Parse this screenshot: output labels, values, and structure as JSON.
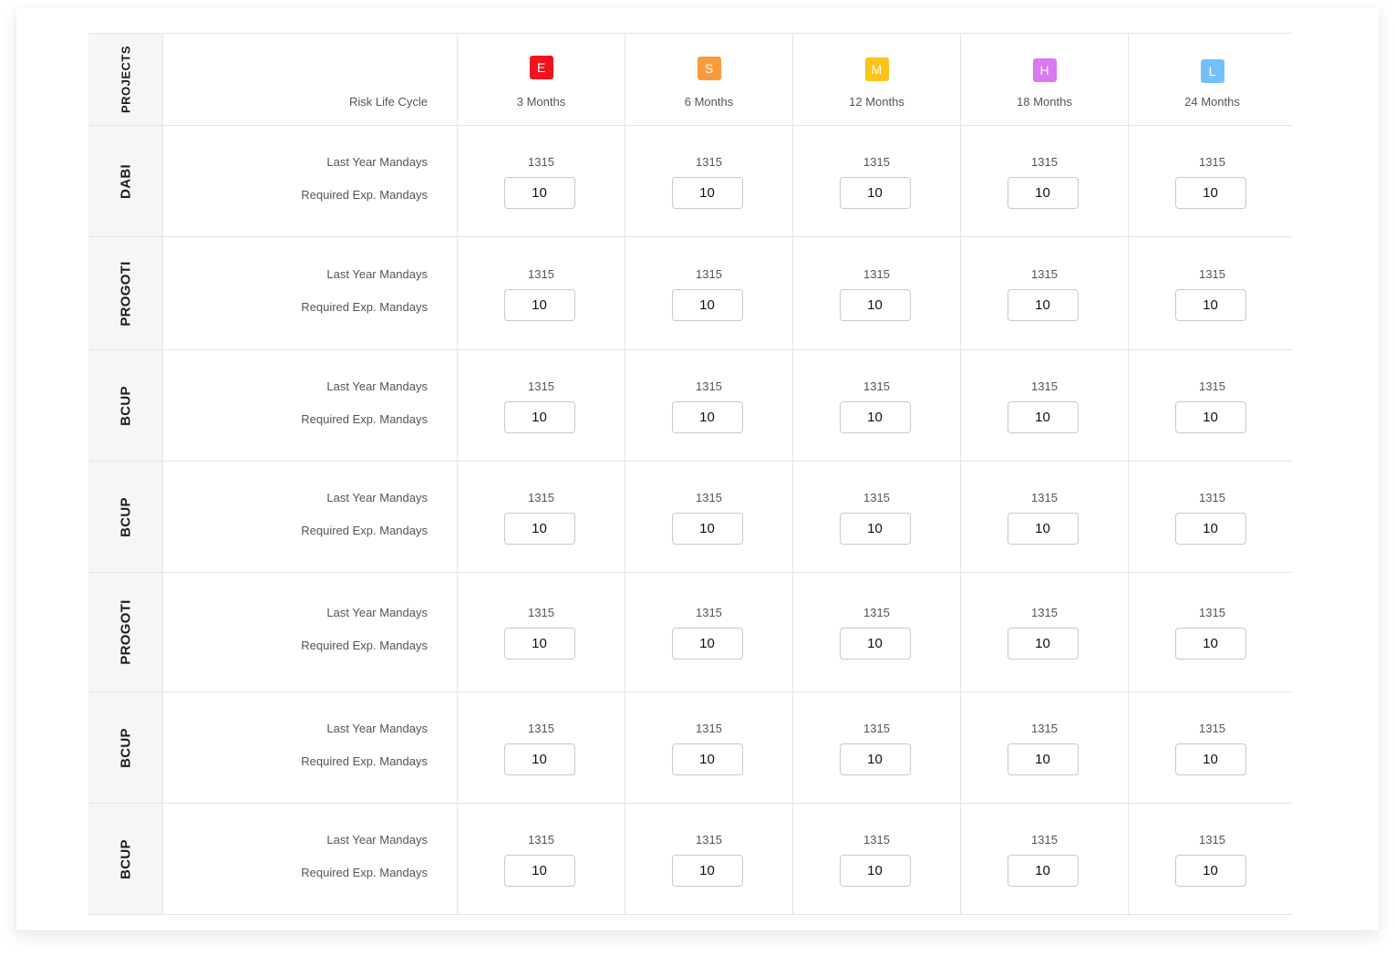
{
  "header": {
    "projects_label": "PROJECTS",
    "risk_label": "Risk Life Cycle",
    "columns": [
      {
        "badge": "E",
        "label": "3 Months",
        "color": "#f0131e"
      },
      {
        "badge": "S",
        "label": "6 Months",
        "color": "#f99a3c"
      },
      {
        "badge": "M",
        "label": "12 Months",
        "color": "#fcc419"
      },
      {
        "badge": "H",
        "label": "18 Months",
        "color": "#da77f2"
      },
      {
        "badge": "L",
        "label": "24 Months",
        "color": "#74c0fc"
      }
    ]
  },
  "row_labels": {
    "last_year": "Last Year Mandays",
    "required": "Required Exp. Mandays"
  },
  "rows": [
    {
      "project": "DABI",
      "values": [
        {
          "last": "1315",
          "required": "10"
        },
        {
          "last": "1315",
          "required": "10"
        },
        {
          "last": "1315",
          "required": "10"
        },
        {
          "last": "1315",
          "required": "10"
        },
        {
          "last": "1315",
          "required": "10"
        }
      ]
    },
    {
      "project": "PROGOTI",
      "values": [
        {
          "last": "1315",
          "required": "10"
        },
        {
          "last": "1315",
          "required": "10"
        },
        {
          "last": "1315",
          "required": "10"
        },
        {
          "last": "1315",
          "required": "10"
        },
        {
          "last": "1315",
          "required": "10"
        }
      ]
    },
    {
      "project": "BCUP",
      "values": [
        {
          "last": "1315",
          "required": "10"
        },
        {
          "last": "1315",
          "required": "10"
        },
        {
          "last": "1315",
          "required": "10"
        },
        {
          "last": "1315",
          "required": "10"
        },
        {
          "last": "1315",
          "required": "10"
        }
      ]
    },
    {
      "project": "BCUP",
      "values": [
        {
          "last": "1315",
          "required": "10"
        },
        {
          "last": "1315",
          "required": "10"
        },
        {
          "last": "1315",
          "required": "10"
        },
        {
          "last": "1315",
          "required": "10"
        },
        {
          "last": "1315",
          "required": "10"
        }
      ]
    },
    {
      "project": "PROGOTI",
      "values": [
        {
          "last": "1315",
          "required": "10"
        },
        {
          "last": "1315",
          "required": "10"
        },
        {
          "last": "1315",
          "required": "10"
        },
        {
          "last": "1315",
          "required": "10"
        },
        {
          "last": "1315",
          "required": "10"
        }
      ]
    },
    {
      "project": "BCUP",
      "values": [
        {
          "last": "1315",
          "required": "10"
        },
        {
          "last": "1315",
          "required": "10"
        },
        {
          "last": "1315",
          "required": "10"
        },
        {
          "last": "1315",
          "required": "10"
        },
        {
          "last": "1315",
          "required": "10"
        }
      ]
    },
    {
      "project": "BCUP",
      "values": [
        {
          "last": "1315",
          "required": "10"
        },
        {
          "last": "1315",
          "required": "10"
        },
        {
          "last": "1315",
          "required": "10"
        },
        {
          "last": "1315",
          "required": "10"
        },
        {
          "last": "1315",
          "required": "10"
        }
      ]
    }
  ]
}
